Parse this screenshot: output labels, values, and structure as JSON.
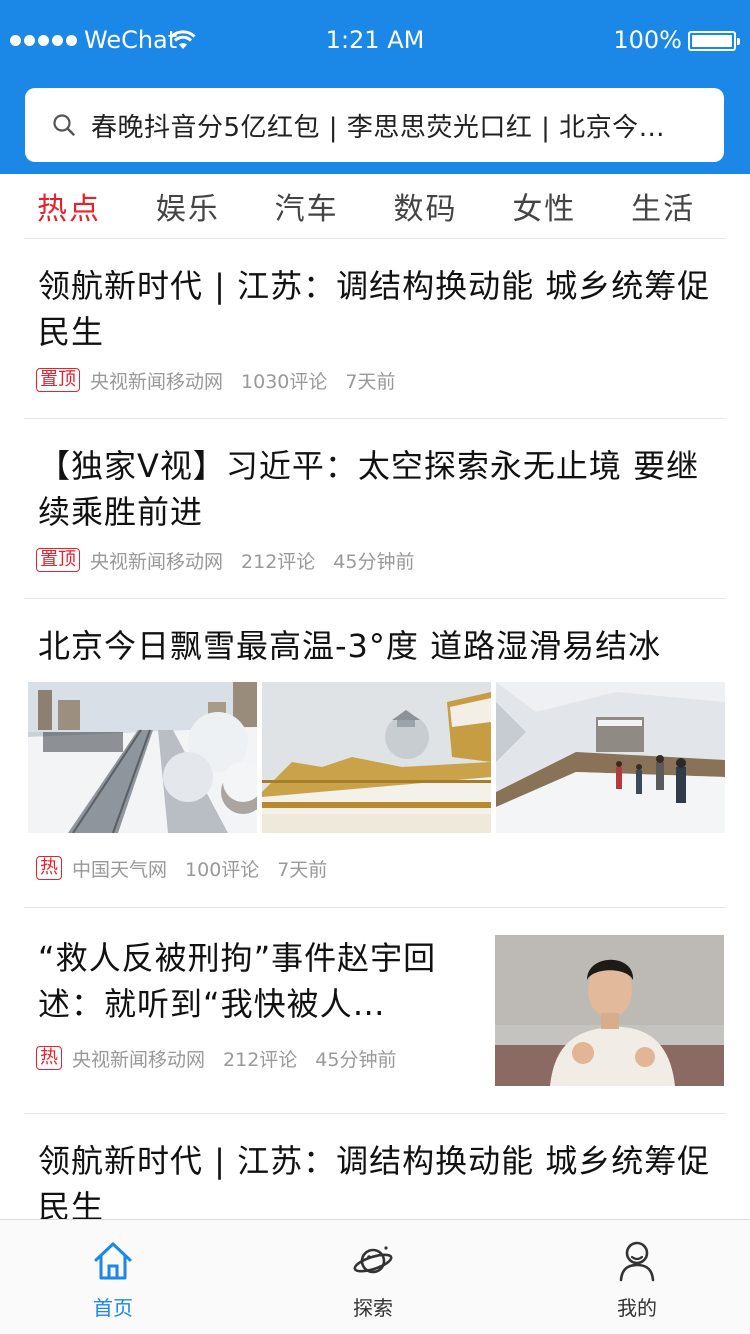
{
  "status_bar": {
    "carrier": "WeChat",
    "time": "1:21 AM",
    "battery": "100%",
    "battery_level": 1.0
  },
  "search": {
    "text": "春晚抖音分5亿红包 | 李思思荧光口红 | 北京今…"
  },
  "tabs": [
    {
      "label": "热点",
      "active": true
    },
    {
      "label": "娱乐",
      "active": false
    },
    {
      "label": "汽车",
      "active": false
    },
    {
      "label": "数码",
      "active": false
    },
    {
      "label": "女性",
      "active": false
    },
    {
      "label": "生活",
      "active": false
    }
  ],
  "articles": [
    {
      "title": "领航新时代 | 江苏：调结构换动能 城乡统筹促民生",
      "badge": "置顶",
      "source": "央视新闻移动网",
      "comments": "1030评论",
      "time": "7天前"
    },
    {
      "title": "【独家V视】习近平：太空探索永无止境 要继续乘胜前进",
      "badge": "置顶",
      "source": "央视新闻移动网",
      "comments": "212评论",
      "time": "45分钟前"
    },
    {
      "title": "北京今日飘雪最高温-3°度 道路湿滑易结冰",
      "badge": "热",
      "source": "中国天气网",
      "comments": "100评论",
      "time": "7天前"
    },
    {
      "title": "“救人反被刑拘”事件赵宇回述：就听到“我快被人…",
      "badge": "热",
      "source": "央视新闻移动网",
      "comments": "212评论",
      "time": "45分钟前"
    },
    {
      "title": "领航新时代 | 江苏：调结构换动能 城乡统筹促民生"
    }
  ],
  "bottom_nav": [
    {
      "label": "首页",
      "icon": "home-icon",
      "active": true
    },
    {
      "label": "探索",
      "icon": "planet-icon",
      "active": false
    },
    {
      "label": "我的",
      "icon": "user-icon",
      "active": false
    }
  ],
  "colors": {
    "primary": "#1b87e6",
    "accent_red": "#e8212c",
    "meta_gray": "#999999"
  }
}
